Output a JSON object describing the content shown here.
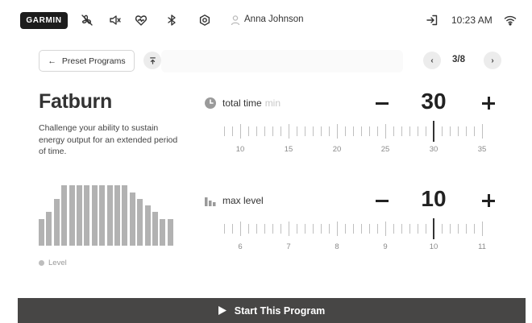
{
  "statusbar": {
    "brand": "GARMIN",
    "user_name": "Anna Johnson",
    "time": "10:23 AM",
    "icons": [
      "no-fan-icon",
      "speaker-icon",
      "heart-rate-icon",
      "bluetooth-icon",
      "settings-icon",
      "user-icon",
      "exit-icon",
      "wifi-icon"
    ]
  },
  "nav": {
    "back_label": "Preset Programs",
    "page_indicator": "3/8"
  },
  "program": {
    "title": "Fatburn",
    "description": "Challenge your ability to sustain energy output for an extended period of time.",
    "legend": "Level",
    "profile_levels": [
      4,
      5,
      7,
      9,
      9,
      9,
      9,
      9,
      9,
      9,
      9,
      9,
      8,
      7,
      6,
      5,
      4,
      4
    ],
    "profile_max": 10
  },
  "time_param": {
    "label": "total time",
    "unit": "min",
    "value": "30",
    "ticks": [
      "10",
      "15",
      "20",
      "25",
      "30",
      "35"
    ]
  },
  "level_param": {
    "label": "max level",
    "value": "10",
    "ticks": [
      "6",
      "7",
      "8",
      "9",
      "10",
      "11"
    ]
  },
  "start_label": "Start This Program",
  "colors": {
    "start_bar": "#474645",
    "profile_bar": "#b2b2b2",
    "text": "#333333"
  }
}
